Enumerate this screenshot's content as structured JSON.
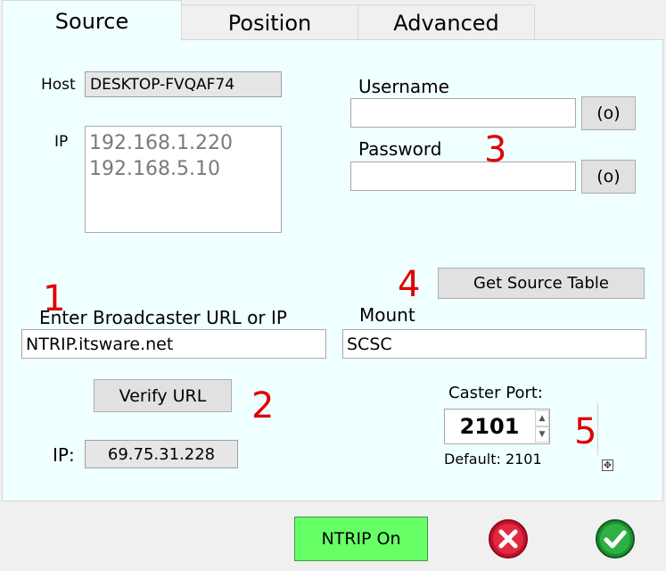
{
  "tabs": [
    {
      "label": "Source"
    },
    {
      "label": "Position"
    },
    {
      "label": "Advanced"
    }
  ],
  "source": {
    "host_label": "Host",
    "host_value": "DESKTOP-FVQAF74",
    "ip_label": "IP",
    "ip_addresses": [
      "192.168.1.220",
      "192.168.5.10"
    ],
    "username_label": "Username",
    "username_value": "",
    "password_label": "Password",
    "password_value": "",
    "reveal_button_label": "(o)",
    "get_source_table_label": "Get Source Table",
    "broadcaster_label": "Enter Broadcaster URL or IP",
    "broadcaster_value": "NTRIP.itsware.net",
    "mount_label": "Mount",
    "mount_value": "SCSC",
    "verify_url_label": "Verify URL",
    "resolved_ip_label": "IP:",
    "resolved_ip_value": "69.75.31.228",
    "caster_port_label": "Caster Port:",
    "caster_port_value": "2101",
    "default_port_text": "Default: 2101"
  },
  "annotations": [
    "1",
    "2",
    "3",
    "4",
    "5"
  ],
  "footer": {
    "ntrip_button_label": "NTRIP On",
    "cancel_icon": "cancel-icon",
    "ok_icon": "check-icon"
  },
  "colors": {
    "panel_bg": "#f0ffff",
    "ntrip_button_bg": "#66ff66",
    "annotation_red": "#e00000",
    "cancel_red": "#c8102e",
    "ok_green": "#1a8f2e"
  }
}
